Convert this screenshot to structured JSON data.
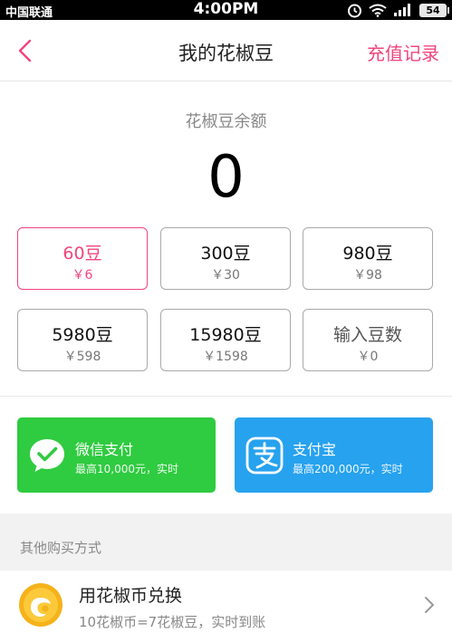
{
  "status_bar": {
    "carrier": "中国联通",
    "time": "4:00PM",
    "battery": "54"
  },
  "nav": {
    "title": "我的花椒豆",
    "right_link": "充值记录"
  },
  "balance": {
    "label": "花椒豆余额",
    "value": "0"
  },
  "packages": [
    {
      "name": "60豆",
      "price": "￥6",
      "selected": true
    },
    {
      "name": "300豆",
      "price": "￥30"
    },
    {
      "name": "980豆",
      "price": "￥98"
    },
    {
      "name": "5980豆",
      "price": "￥598"
    },
    {
      "name": "15980豆",
      "price": "￥1598"
    },
    {
      "name": "输入豆数",
      "price": "￥0"
    }
  ],
  "payment": {
    "wechat": {
      "title": "微信支付",
      "subtitle": "最高10,000元，实时"
    },
    "alipay": {
      "title": "支付宝",
      "subtitle": "最高200,000元，实时"
    }
  },
  "other": {
    "label": "其他购买方式",
    "exchange_title": "用花椒币兑换",
    "exchange_subtitle": "10花椒币=7花椒豆，实时到账"
  },
  "colors": {
    "accent": "#f0457c",
    "wechat": "#2fcb40",
    "alipay": "#27a2ee",
    "coin": "#f5b21a"
  }
}
